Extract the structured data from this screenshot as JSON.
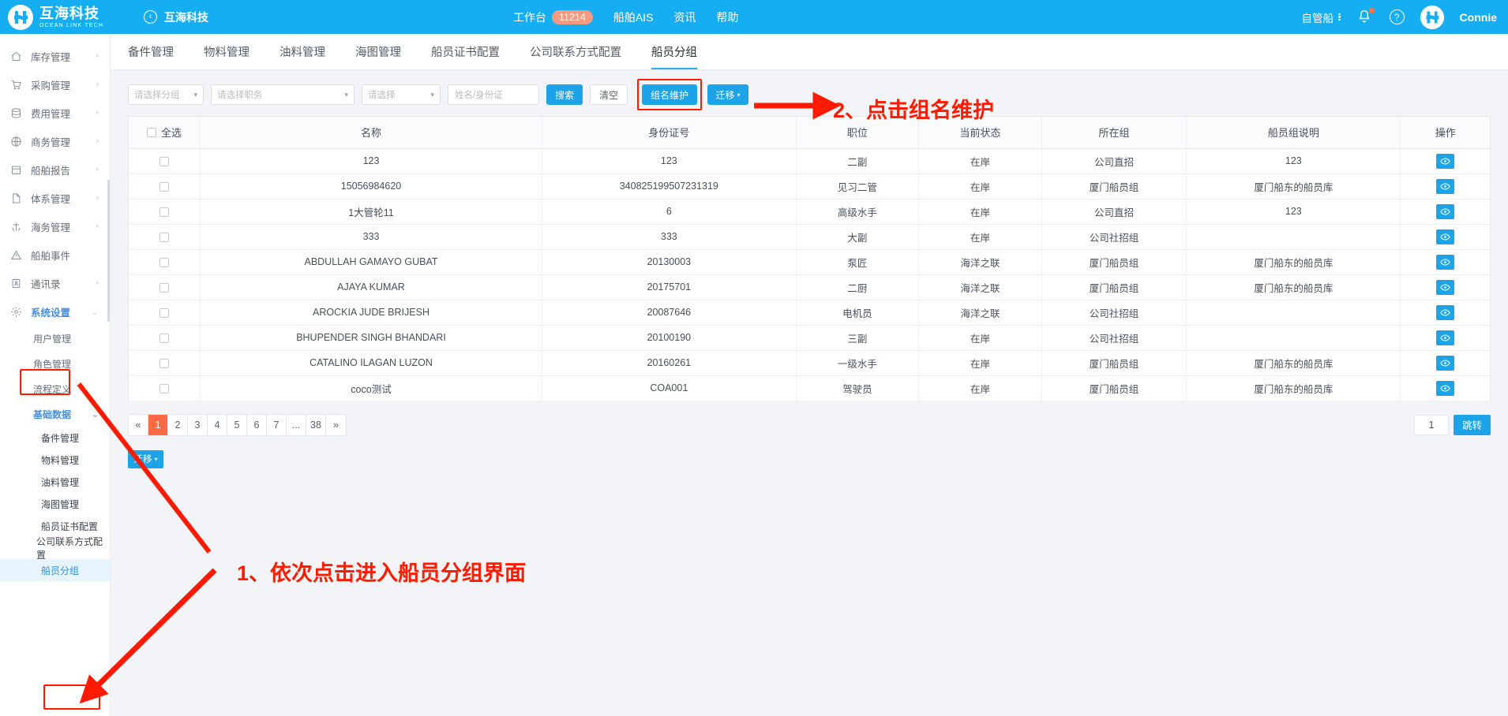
{
  "topbar": {
    "brand_cn": "互海科技",
    "brand_en": "OCEAN LINK TECH",
    "back_label": "互海科技",
    "nav": [
      {
        "label": "工作台",
        "badge": "11214"
      },
      {
        "label": "船舶AIS",
        "badge": ""
      },
      {
        "label": "资讯",
        "badge": ""
      },
      {
        "label": "帮助",
        "badge": ""
      }
    ],
    "self_ship": "自管船",
    "username": "Connie"
  },
  "sidebar": {
    "items": [
      {
        "label": "库存管理",
        "icon": "home-icon",
        "arrow": "›"
      },
      {
        "label": "采购管理",
        "icon": "cart-icon",
        "arrow": "›"
      },
      {
        "label": "费用管理",
        "icon": "database-icon",
        "arrow": "›"
      },
      {
        "label": "商务管理",
        "icon": "globe-icon",
        "arrow": "›"
      },
      {
        "label": "船舶报告",
        "icon": "calendar-icon",
        "arrow": "›"
      },
      {
        "label": "体系管理",
        "icon": "document-icon",
        "arrow": "›"
      },
      {
        "label": "海务管理",
        "icon": "anchor-icon",
        "arrow": "›"
      },
      {
        "label": "船舶事件",
        "icon": "warning-icon",
        "arrow": ""
      },
      {
        "label": "通讯录",
        "icon": "contacts-icon",
        "arrow": "›"
      },
      {
        "label": "系统设置",
        "icon": "gear-icon",
        "arrow": "⌄"
      }
    ],
    "sub_items": [
      {
        "label": "用户管理",
        "arrow": ""
      },
      {
        "label": "角色管理",
        "arrow": ""
      },
      {
        "label": "流程定义",
        "arrow": ""
      },
      {
        "label": "基础数据",
        "arrow": "⌄"
      }
    ],
    "sub2_items": [
      "备件管理",
      "物料管理",
      "油料管理",
      "海图管理",
      "船员证书配置",
      "公司联系方式配置",
      "船员分组"
    ],
    "selected_sub2": "船员分组"
  },
  "tabs": [
    {
      "label": "备件管理"
    },
    {
      "label": "物料管理"
    },
    {
      "label": "油料管理"
    },
    {
      "label": "海图管理"
    },
    {
      "label": "船员证书配置"
    },
    {
      "label": "公司联系方式配置"
    },
    {
      "label": "船员分组"
    }
  ],
  "active_tab": "船员分组",
  "filters": {
    "group_placeholder": "请选择分组",
    "position_placeholder": "请选择职务",
    "status_placeholder": "请选择",
    "name_placeholder": "姓名/身份证",
    "search_label": "搜索",
    "clear_label": "清空",
    "group_maintain_label": "组名维护",
    "migrate_label": "迁移"
  },
  "table": {
    "headers": [
      "全选",
      "名称",
      "身份证号",
      "职位",
      "当前状态",
      "所在组",
      "船员组说明",
      "操作"
    ],
    "rows": [
      {
        "name": "123",
        "id_no": "123",
        "position": "二副",
        "status": "在岸",
        "group": "公司直招",
        "note": "123"
      },
      {
        "name": "15056984620",
        "id_no": "340825199507231319",
        "position": "见习二管",
        "status": "在岸",
        "group": "厦门船员组",
        "note": "厦门船东的船员库"
      },
      {
        "name": "1大管轮11",
        "id_no": "6",
        "position": "高级水手",
        "status": "在岸",
        "group": "公司直招",
        "note": "123"
      },
      {
        "name": "333",
        "id_no": "333",
        "position": "大副",
        "status": "在岸",
        "group": "公司社招组",
        "note": ""
      },
      {
        "name": "ABDULLAH GAMAYO GUBAT",
        "id_no": "20130003",
        "position": "泵匠",
        "status": "海洋之联",
        "group": "厦门船员组",
        "note": "厦门船东的船员库"
      },
      {
        "name": "AJAYA KUMAR",
        "id_no": "20175701",
        "position": "二厨",
        "status": "海洋之联",
        "group": "厦门船员组",
        "note": "厦门船东的船员库"
      },
      {
        "name": "AROCKIA JUDE BRIJESH",
        "id_no": "20087646",
        "position": "电机员",
        "status": "海洋之联",
        "group": "公司社招组",
        "note": ""
      },
      {
        "name": "BHUPENDER SINGH BHANDARI",
        "id_no": "20100190",
        "position": "三副",
        "status": "在岸",
        "group": "公司社招组",
        "note": ""
      },
      {
        "name": "CATALINO ILAGAN LUZON",
        "id_no": "20160261",
        "position": "一级水手",
        "status": "在岸",
        "group": "厦门船员组",
        "note": "厦门船东的船员库"
      },
      {
        "name": "coco测试",
        "id_no": "COA001",
        "position": "驾驶员",
        "status": "在岸",
        "group": "厦门船员组",
        "note": "厦门船东的船员库"
      }
    ]
  },
  "pagination": {
    "prev": "«",
    "pages": [
      "1",
      "2",
      "3",
      "4",
      "5",
      "6",
      "7",
      "...",
      "38"
    ],
    "next": "»",
    "current": "1",
    "jump_value": "1",
    "jump_label": "跳转"
  },
  "annotations": [
    {
      "id": "anno1",
      "text": "1、依次点击进入船员分组界面"
    },
    {
      "id": "anno2",
      "text": "2、点击组名维护"
    }
  ],
  "colors": {
    "brand_blue": "#16AEF3",
    "accent_blue": "#1CA3E8",
    "annotation_red": "#FF1A00",
    "page_active": "#FF6A43",
    "badge_orange": "#F79A82"
  }
}
